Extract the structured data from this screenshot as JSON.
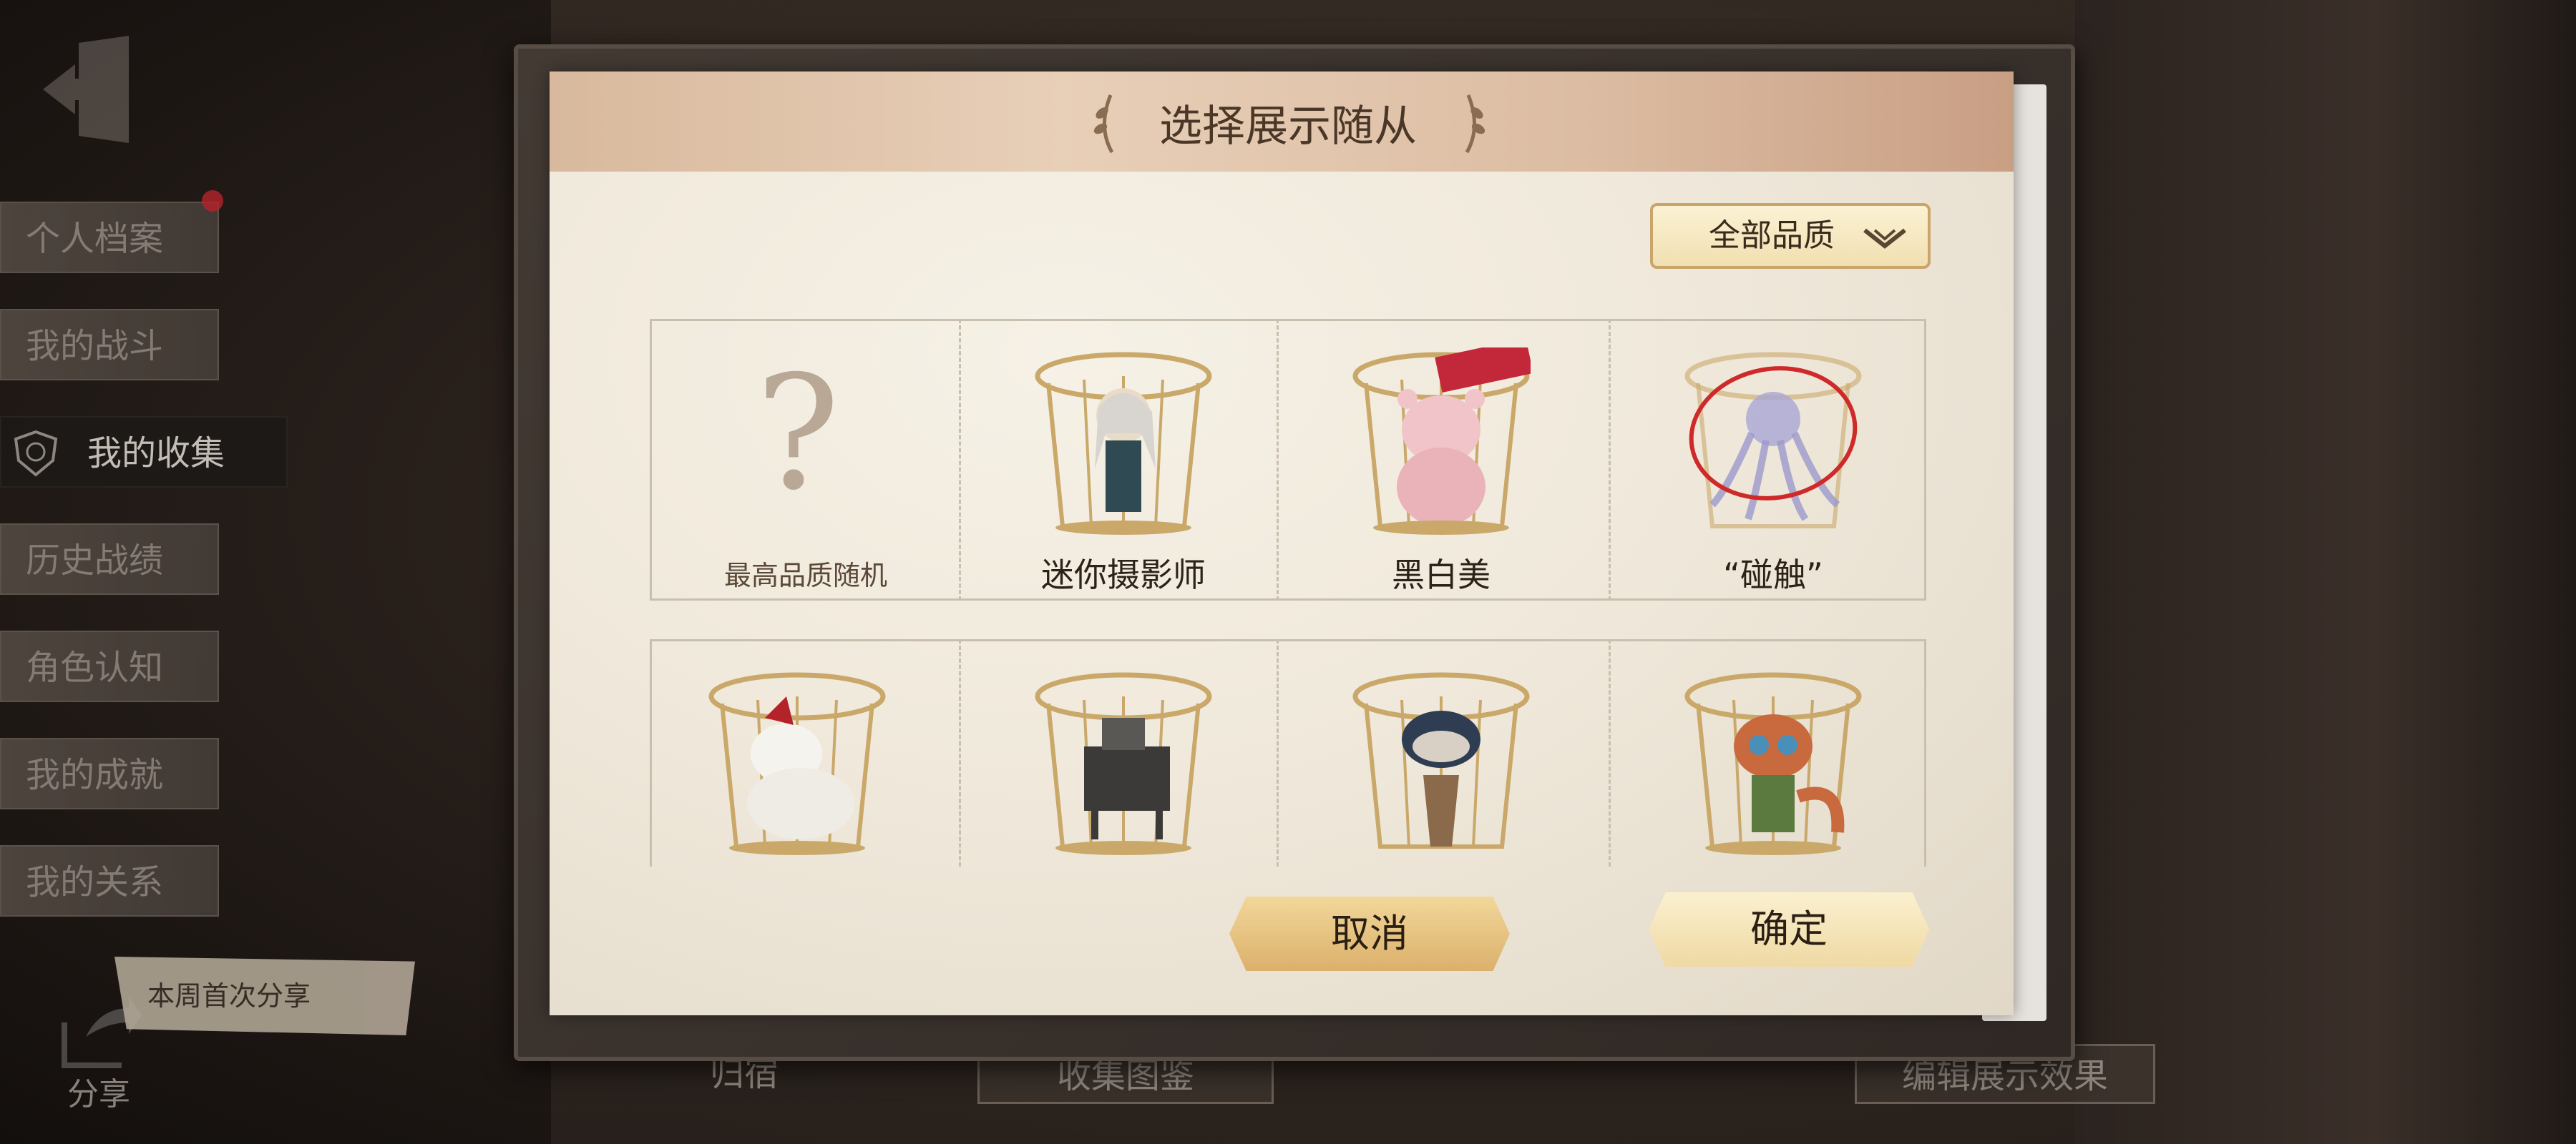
{
  "dialog": {
    "title": "选择展示随从",
    "filter_dropdown": {
      "selected": "全部品质"
    },
    "items": [
      {
        "label": "最高品质随机",
        "icon": "question-mark-icon"
      },
      {
        "label": "迷你摄影师",
        "icon": "photographer-companion-icon"
      },
      {
        "label": "黑白美",
        "icon": "pink-bear-companion-icon"
      },
      {
        "label": "“碰触”",
        "icon": "ghost-octopus-companion-icon"
      },
      {
        "label": "",
        "icon": "white-fox-companion-icon"
      },
      {
        "label": "",
        "icon": "machine-companion-icon"
      },
      {
        "label": "",
        "icon": "masked-bird-companion-icon"
      },
      {
        "label": "",
        "icon": "red-panda-companion-icon"
      }
    ],
    "cancel_label": "取消",
    "confirm_label": "确定"
  },
  "sidebar": {
    "items": [
      {
        "label": "个人档案"
      },
      {
        "label": "我的战斗"
      },
      {
        "label": "我的收集"
      },
      {
        "label": "历史战绩"
      },
      {
        "label": "角色认知"
      },
      {
        "label": "我的成就"
      },
      {
        "label": "我的关系"
      }
    ],
    "share_bubble": "本周首次分享",
    "share_label": "分享"
  },
  "background_buttons": {
    "dormitory": "归宿",
    "collection_guide": "收集图鉴",
    "edit_display": "编辑展示效果"
  },
  "colors": {
    "accent_gold": "#dbb06b",
    "title_bar": "#e8cfb8",
    "paper": "#efe8da"
  }
}
